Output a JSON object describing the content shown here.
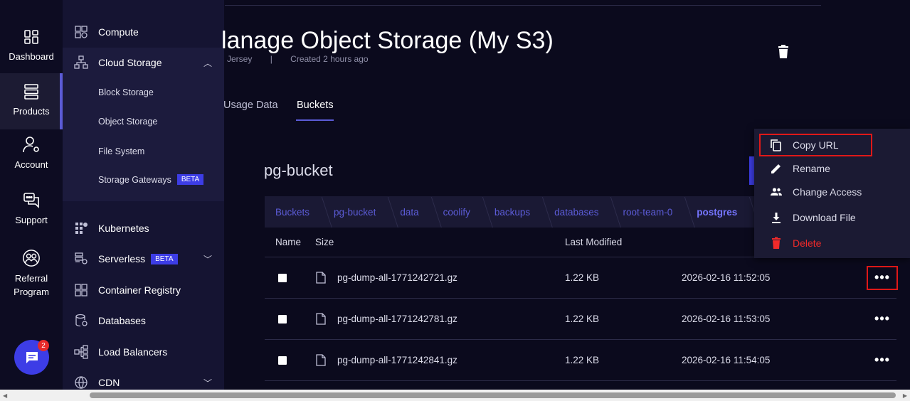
{
  "rail": {
    "items": [
      {
        "label": "Dashboard",
        "icon": "dashboard-icon"
      },
      {
        "label": "Products",
        "icon": "products-icon"
      },
      {
        "label": "Account",
        "icon": "account-icon"
      },
      {
        "label": "Support",
        "icon": "support-icon"
      },
      {
        "label": "Referral\nProgram",
        "icon": "referral-icon"
      }
    ],
    "chat_badge": "2"
  },
  "subnav": {
    "compute": "Compute",
    "cloud_storage": "Cloud Storage",
    "block_storage": "Block Storage",
    "object_storage": "Object Storage",
    "file_system": "File System",
    "storage_gateways": "Storage Gateways",
    "beta": "BETA",
    "kubernetes": "Kubernetes",
    "serverless": "Serverless",
    "container_registry": "Container Registry",
    "databases": "Databases",
    "load_balancers": "Load Balancers",
    "cdn": "CDN"
  },
  "header": {
    "title": "lanage Object Storage (My S3)",
    "location": "Jersey",
    "separator": "|",
    "created": "Created 2 hours ago"
  },
  "tabs": [
    {
      "label": "Usage Data"
    },
    {
      "label": "Buckets"
    }
  ],
  "bucket": {
    "name": "pg-bucket",
    "breadcrumb": [
      "Buckets",
      "pg-bucket",
      "data",
      "coolify",
      "backups",
      "databases",
      "root-team-0",
      "postgres"
    ]
  },
  "table": {
    "headers": {
      "name": "Name",
      "size": "Size",
      "last_modified": "Last Modified"
    },
    "rows": [
      {
        "name": "pg-dump-all-1771242721.gz",
        "size": "1.22 KB",
        "modified": "2026-02-16 11:52:05"
      },
      {
        "name": "pg-dump-all-1771242781.gz",
        "size": "1.22 KB",
        "modified": "2026-02-16 11:53:05"
      },
      {
        "name": "pg-dump-all-1771242841.gz",
        "size": "1.22 KB",
        "modified": "2026-02-16 11:54:05"
      }
    ],
    "actions_glyph": "•••"
  },
  "menu": {
    "copy_url": "Copy URL",
    "rename": "Rename",
    "change_access": "Change Access",
    "download_file": "Download File",
    "delete": "Delete"
  },
  "colors": {
    "accent": "#5b5bd6",
    "danger": "#ef2a2a",
    "highlight": "#e01818"
  }
}
